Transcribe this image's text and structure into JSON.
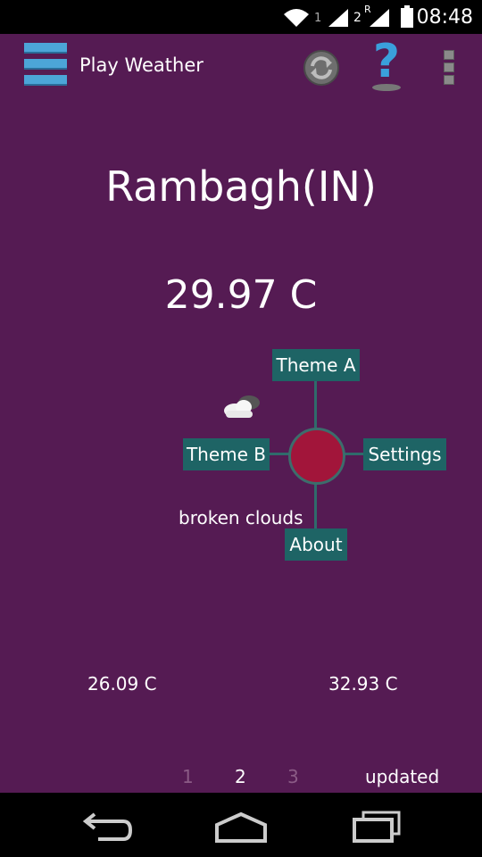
{
  "status_bar": {
    "time": "08:48",
    "sim1_label": "1",
    "sim2_label": "2",
    "roaming_label": "R",
    "icons": [
      "wifi-icon",
      "signal-icon",
      "signal-icon",
      "battery-icon"
    ]
  },
  "action_bar": {
    "title": "Play Weather",
    "icons": [
      "menu-icon",
      "refresh-icon",
      "help-icon",
      "overflow-icon"
    ]
  },
  "weather": {
    "city": "Rambagh(IN)",
    "temperature": "29.97 C",
    "description": "broken clouds",
    "icon": "broken-clouds-icon",
    "min_temp": "26.09 C",
    "max_temp": "32.93 C"
  },
  "radial_menu": {
    "top": "Theme A",
    "left": "Theme B",
    "right": "Settings",
    "bottom": "About"
  },
  "pager": {
    "pages": [
      "1",
      "2",
      "3"
    ],
    "current": "2",
    "status": "updated"
  },
  "nav_bar": {
    "icons": [
      "back-icon",
      "home-icon",
      "recents-icon"
    ]
  },
  "colors": {
    "background": "#551b53",
    "accent": "#1e6465",
    "center_button": "#a2153a"
  }
}
